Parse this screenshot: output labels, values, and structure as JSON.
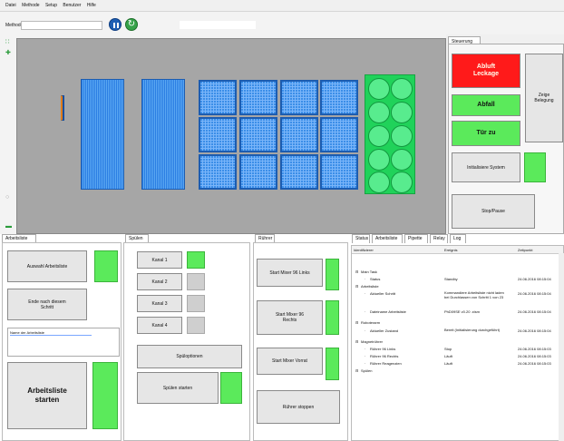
{
  "menu": [
    "Datei",
    "Methode",
    "Setup",
    "Benutzer",
    "Hilfe"
  ],
  "toolbar": {
    "method_label": "Methode",
    "method_value": ""
  },
  "right_panel": {
    "tab": "Steuerung",
    "leak": "Abluft\nLeckage",
    "abfall": "Abfall",
    "door": "Tür zu",
    "show_occupancy": "Zeige\nBelegung",
    "init_system": "Initialisiere System",
    "stop_pause": "Stop/Pause",
    "colors": {
      "red": "#ff1a1a",
      "green": "#5bea5b"
    }
  },
  "worklist": {
    "tab": "Arbeitsliste",
    "select_btn": "Auswahl Arbeitsliste",
    "end_btn": "Ende nach diesem\nSchritt",
    "name_label": "Name der Arbeitsliste",
    "start_btn": "Arbeitsliste\nstarten"
  },
  "rinse": {
    "tab": "Spülen",
    "channels": [
      "Kanal 1",
      "Kanal 2",
      "Kanal 3",
      "Kanal 4"
    ],
    "options_btn": "Spüloptionen",
    "start_btn": "Spülen starten"
  },
  "stirrer": {
    "tab": "Rührer",
    "btn1": "Start Mixer 96 Links",
    "btn2": "Start Mixer 96\nRechts",
    "btn3": "Start Mixer Vorrat",
    "btn4": "Rührer stoppen"
  },
  "status": {
    "tabs": [
      "Status",
      "Arbeitsliste",
      "Pipette",
      "Relay",
      "Log"
    ],
    "columns": [
      "Identifizierer",
      "Ereignis",
      "Zeitpunkt"
    ],
    "rows": [
      {
        "l": 0,
        "id": "Main Task",
        "ev": "",
        "t": ""
      },
      {
        "l": 1,
        "id": "Status",
        "ev": "Standby",
        "t": "24.06.2016 08:15:04"
      },
      {
        "l": 0,
        "id": "Arbeitsliste",
        "ev": "",
        "t": ""
      },
      {
        "l": 1,
        "id": "Aktueller Schritt",
        "ev": "Kommandiere Arbeitsliste nicht laden bei Durchlassen von Schritt 1 von 23",
        "t": "24.06.2016 08:15:04"
      },
      {
        "l": 1,
        "id": "Dateiname Arbeitsliste",
        "ev": "PhD09SE v0.20 .xlsm",
        "t": "24.06.2016 08:15:04"
      },
      {
        "l": 0,
        "id": "Roboterarm",
        "ev": "",
        "t": ""
      },
      {
        "l": 1,
        "id": "Aktueller Zustand",
        "ev": "Bereit (Initialisierung durchgeführt)",
        "t": "24.06.2016 08:15:04"
      },
      {
        "l": 0,
        "id": "Magnetrührer",
        "ev": "",
        "t": ""
      },
      {
        "l": 1,
        "id": "Rührer 96 Links",
        "ev": "Stop",
        "t": "24.06.2016 08:15:03"
      },
      {
        "l": 1,
        "id": "Rührer 96 Rechts",
        "ev": "Läuft",
        "t": "24.06.2016 08:15:03"
      },
      {
        "l": 1,
        "id": "Rührer Reagenzien",
        "ev": "Läuft",
        "t": "24.06.2016 08:15:03"
      },
      {
        "l": 0,
        "id": "Spülen",
        "ev": "",
        "t": ""
      }
    ]
  }
}
